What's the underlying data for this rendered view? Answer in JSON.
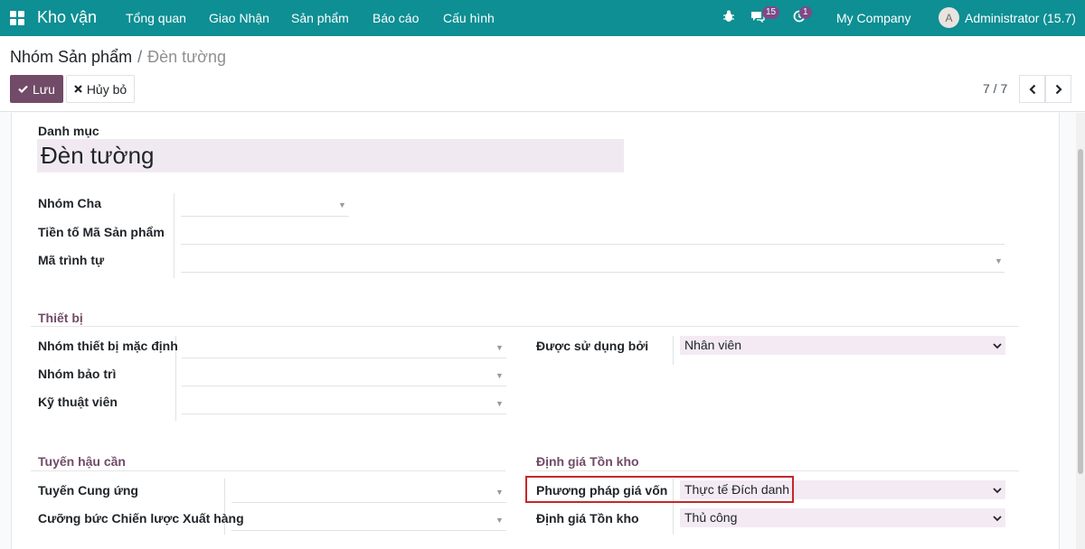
{
  "navbar": {
    "app_name": "Kho vận",
    "menu": [
      "Tổng quan",
      "Giao Nhận",
      "Sản phẩm",
      "Báo cáo",
      "Cấu hình"
    ],
    "messages_count": "15",
    "activities_count": "1",
    "company": "My Company",
    "avatar_letter": "A",
    "user": "Administrator (15.7)"
  },
  "breadcrumb": {
    "parent": "Nhóm Sản phẩm",
    "separator": "/",
    "current": "Đèn tường"
  },
  "buttons": {
    "save": "Lưu",
    "discard": "Hủy bỏ"
  },
  "pager": {
    "value": "7 / 7"
  },
  "form": {
    "category_label": "Danh mục",
    "category_value": "Đèn tường",
    "parent_label": "Nhóm Cha",
    "prefix_label": "Tiền tố Mã Sản phẩm",
    "sequence_label": "Mã trình tự",
    "equipment_section": "Thiết bị",
    "default_equipment_label": "Nhóm thiết bị mặc định",
    "maintenance_team_label": "Nhóm bảo trì",
    "technician_label": "Kỹ thuật viên",
    "used_by_label": "Được sử dụng bởi",
    "used_by_value": "Nhân viên",
    "logistics_section": "Tuyến hậu cần",
    "routes_label": "Tuyến Cung ứng",
    "removal_label": "Cưỡng bức Chiến lược Xuất hàng",
    "valuation_section": "Định giá Tồn kho",
    "costing_label": "Phương pháp giá vốn",
    "costing_value": "Thực tế Đích danh",
    "valuation_label": "Định giá Tồn kho",
    "valuation_value": "Thủ công"
  },
  "colors": {
    "navbar": "#0d8f93",
    "primary": "#714b67",
    "highlight": "#c62828"
  }
}
